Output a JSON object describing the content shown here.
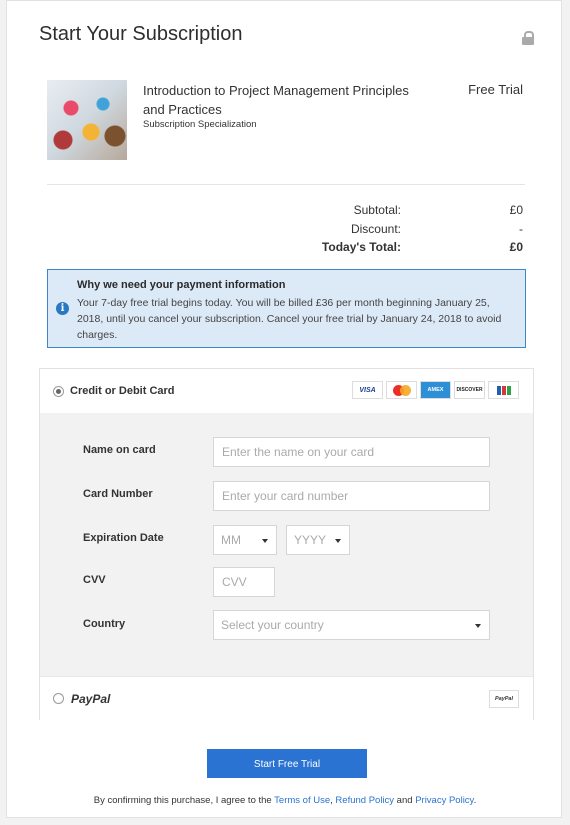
{
  "header": {
    "title": "Start Your Subscription",
    "lock_icon": "lock-icon"
  },
  "course": {
    "title": "Introduction to Project Management Principles and Practices",
    "subtitle": "Subscription Specialization",
    "price_label": "Free Trial"
  },
  "summary": {
    "subtotal_label": "Subtotal:",
    "subtotal_value": "£0",
    "discount_label": "Discount:",
    "discount_value": "-",
    "total_label": "Today's Total:",
    "total_value": "£0"
  },
  "info": {
    "heading": "Why we need your payment information",
    "text": "Your 7-day free trial begins today. You will be billed £36 per month beginning January 25, 2018, until you cancel your subscription. Cancel your free trial by January 24, 2018 to avoid charges.",
    "icon": "i"
  },
  "payment": {
    "card_option": "Credit or Debit Card",
    "card_brands": [
      "VISA",
      "MasterCard",
      "AMEX",
      "DISCOVER",
      "JCB"
    ],
    "fields": {
      "name_label": "Name on card",
      "name_placeholder": "Enter the name on your card",
      "number_label": "Card Number",
      "number_placeholder": "Enter your card number",
      "expiry_label": "Expiration Date",
      "month_value": "MM",
      "year_value": "YYYY",
      "cvv_label": "CVV",
      "cvv_placeholder": "CVV",
      "country_label": "Country",
      "country_value": "Select your country"
    },
    "paypal_option": "PayPal",
    "paypal_badge": "PayPal"
  },
  "cta": {
    "label": "Start Free Trial"
  },
  "legal": {
    "prefix": "By confirming this purchase, I agree to the ",
    "terms": "Terms of Use",
    "sep1": ", ",
    "refund": "Refund Policy",
    "sep2": " and ",
    "privacy": "Privacy Policy",
    "suffix": "."
  },
  "colors": {
    "accent": "#2a73d2",
    "info_bg": "#dce9f7",
    "info_border": "#3e86c6"
  }
}
